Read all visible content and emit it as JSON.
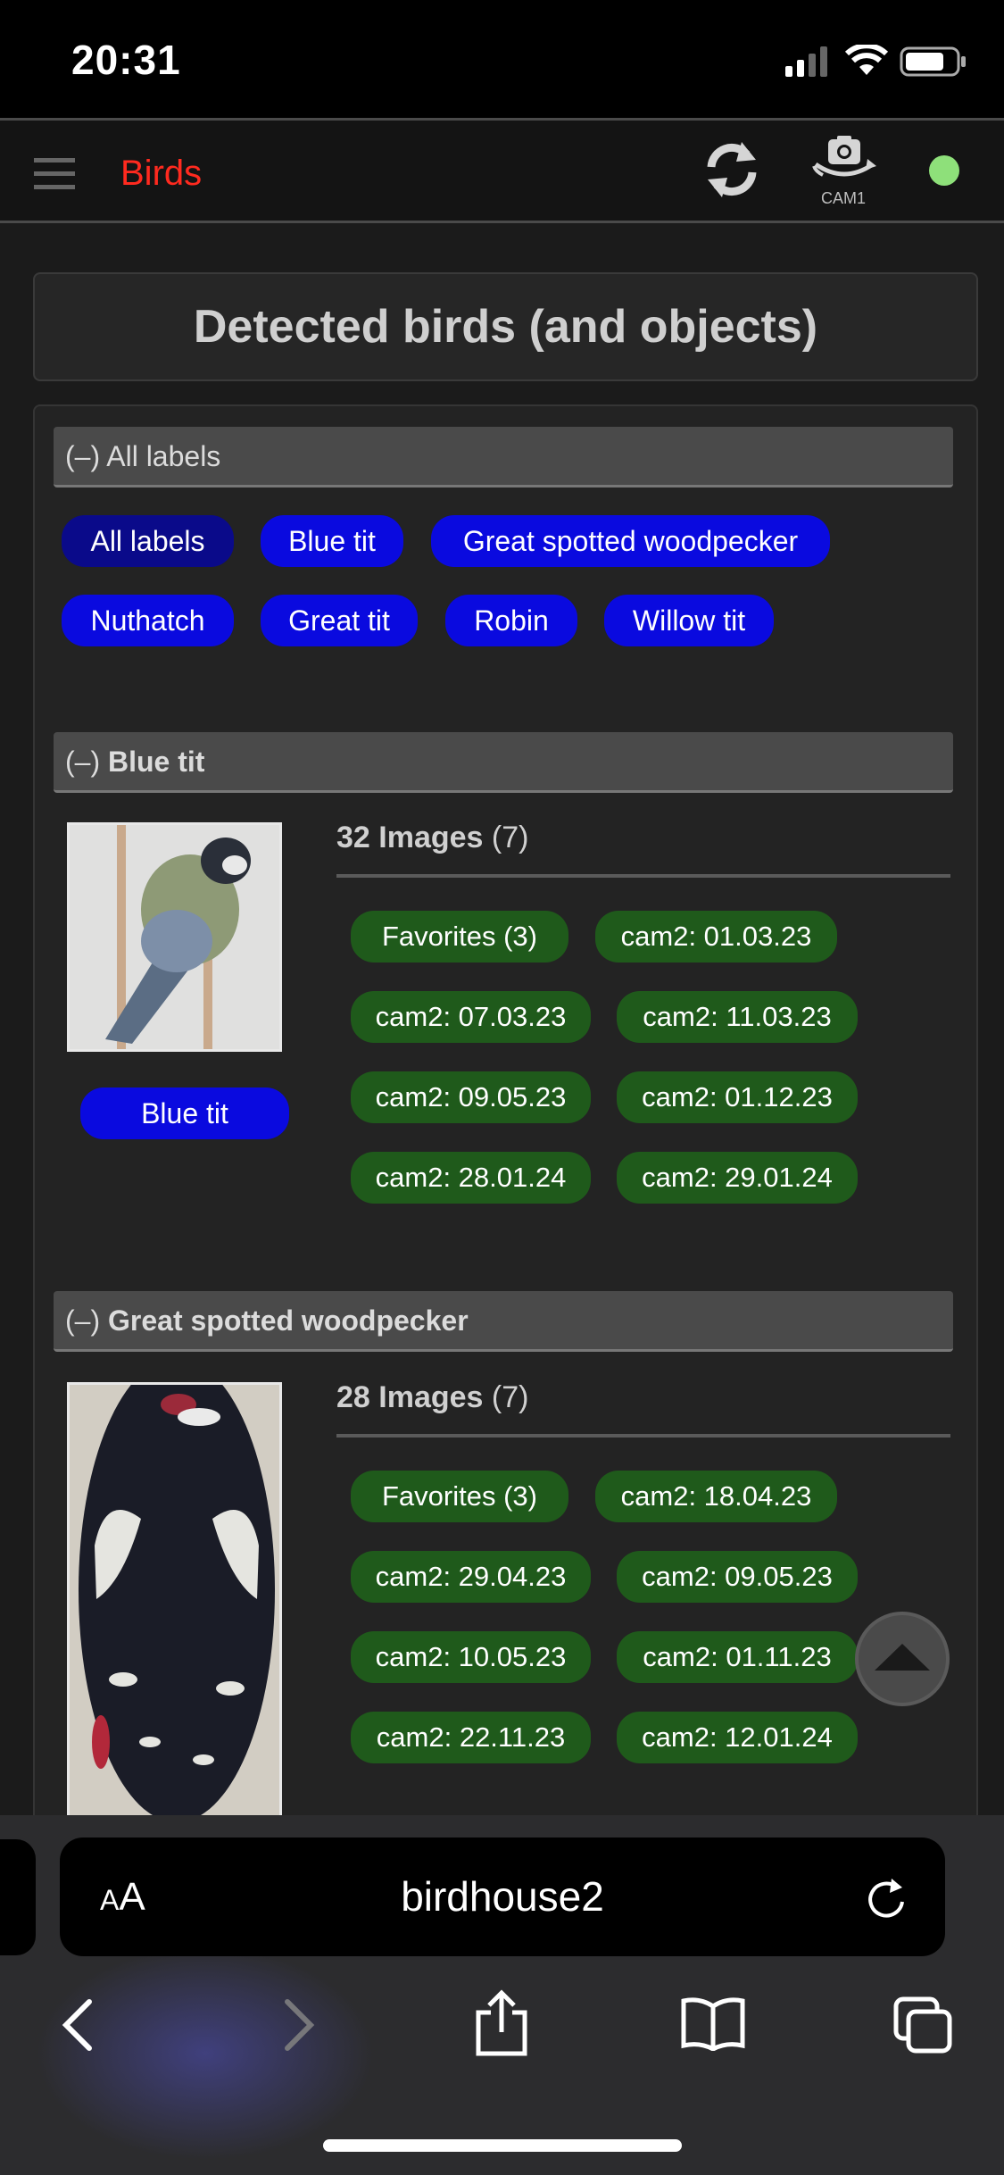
{
  "status_bar": {
    "time": "20:31"
  },
  "header": {
    "title": "Birds",
    "cam_label": "CAM1"
  },
  "page_title": "Detected birds (and objects)",
  "all_labels": {
    "toggle": "(–)",
    "header": "All labels",
    "chips": [
      "All labels",
      "Blue tit",
      "Great spotted woodpecker",
      "Nuthatch",
      "Great tit",
      "Robin",
      "Willow tit"
    ]
  },
  "sections": [
    {
      "toggle": "(–)",
      "name": "Blue tit",
      "count_strong": "32 Images",
      "count_extra": "(7)",
      "label_button": "Blue tit",
      "chips": [
        "Favorites (3)",
        "cam2: 01.03.23",
        "cam2: 07.03.23",
        "cam2: 11.03.23",
        "cam2: 09.05.23",
        "cam2: 01.12.23",
        "cam2: 28.01.24",
        "cam2: 29.01.24"
      ]
    },
    {
      "toggle": "(–)",
      "name": "Great spotted woodpecker",
      "count_strong": "28 Images",
      "count_extra": "(7)",
      "chips": [
        "Favorites (3)",
        "cam2: 18.04.23",
        "cam2: 29.04.23",
        "cam2: 09.05.23",
        "cam2: 10.05.23",
        "cam2: 01.11.23",
        "cam2: 22.11.23",
        "cam2: 12.01.24"
      ]
    }
  ],
  "browser": {
    "url": "birdhouse2",
    "aa_label_small": "A",
    "aa_label_large": "A"
  },
  "colors": {
    "accent": "#ff2a1f",
    "chip_blue": "#0a0adf",
    "chip_green": "#1f5a1b",
    "online": "#8ee07a"
  }
}
